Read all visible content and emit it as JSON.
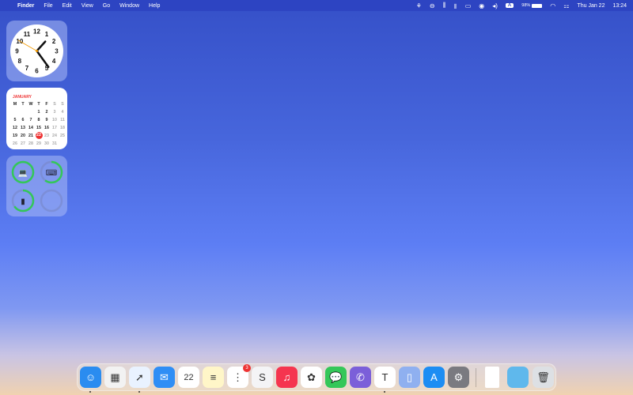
{
  "menubar": {
    "apple": "",
    "app": "Finder",
    "items": [
      "File",
      "Edit",
      "View",
      "Go",
      "Window",
      "Help"
    ],
    "battery": "98%",
    "input_source": "A",
    "date": "Thu Jan 22",
    "time": "13:24"
  },
  "clock": {
    "numbers": [
      "12",
      "1",
      "2",
      "3",
      "4",
      "5",
      "6",
      "7",
      "8",
      "9",
      "10",
      "11"
    ],
    "hour": 13,
    "minute": 24,
    "second": 50
  },
  "calendar": {
    "month": "JANUARY",
    "weekdays": [
      "M",
      "T",
      "W",
      "T",
      "F",
      "S",
      "S"
    ],
    "leading_blanks": 3,
    "days": 31,
    "today": 22
  },
  "batteries": [
    {
      "device": "laptop",
      "level": 1.0
    },
    {
      "device": "keyboard",
      "level": 0.6
    },
    {
      "device": "mouse",
      "level": 0.65
    },
    {
      "device": "empty",
      "level": 0
    }
  ],
  "dock": {
    "apps": [
      {
        "name": "Finder",
        "bg": "#2a8cf0",
        "glyph": "☺",
        "running": true
      },
      {
        "name": "Launchpad",
        "bg": "#f2f2f2",
        "glyph": "▦",
        "running": false
      },
      {
        "name": "Safari",
        "bg": "#e9f2ff",
        "glyph": "➚",
        "running": true
      },
      {
        "name": "Mail",
        "bg": "#2f8ef5",
        "glyph": "✉",
        "running": false
      },
      {
        "name": "Calendar",
        "bg": "#ffffff",
        "glyph": "22",
        "running": false
      },
      {
        "name": "Notes",
        "bg": "#fff6c8",
        "glyph": "≡",
        "running": false
      },
      {
        "name": "Reminders",
        "bg": "#ffffff",
        "glyph": "⋮",
        "running": false,
        "badge": "3"
      },
      {
        "name": "Scrivener",
        "bg": "#f4f4f6",
        "glyph": "S",
        "running": false
      },
      {
        "name": "Music",
        "bg": "#f5354f",
        "glyph": "♫",
        "running": false
      },
      {
        "name": "Photos",
        "bg": "#ffffff",
        "glyph": "✿",
        "running": false
      },
      {
        "name": "Messages",
        "bg": "#34c759",
        "glyph": "💬",
        "running": false
      },
      {
        "name": "Viber",
        "bg": "#7b5fd9",
        "glyph": "✆",
        "running": false
      },
      {
        "name": "Microsoft Teams",
        "bg": "#ffffff",
        "glyph": "T",
        "running": true
      },
      {
        "name": "Simulator",
        "bg": "#8fb0f0",
        "glyph": "▯",
        "running": false
      },
      {
        "name": "App Store",
        "bg": "#1c8df3",
        "glyph": "A",
        "running": false
      },
      {
        "name": "System Settings",
        "bg": "#7a7a80",
        "glyph": "⚙",
        "running": false
      }
    ],
    "extras": [
      {
        "name": "Document",
        "bg": "#ffffff",
        "glyph": ""
      },
      {
        "name": "Folder",
        "bg": "#5fb8ec",
        "glyph": ""
      },
      {
        "name": "Trash",
        "bg": "#dde0e4",
        "glyph": "🗑"
      }
    ]
  }
}
